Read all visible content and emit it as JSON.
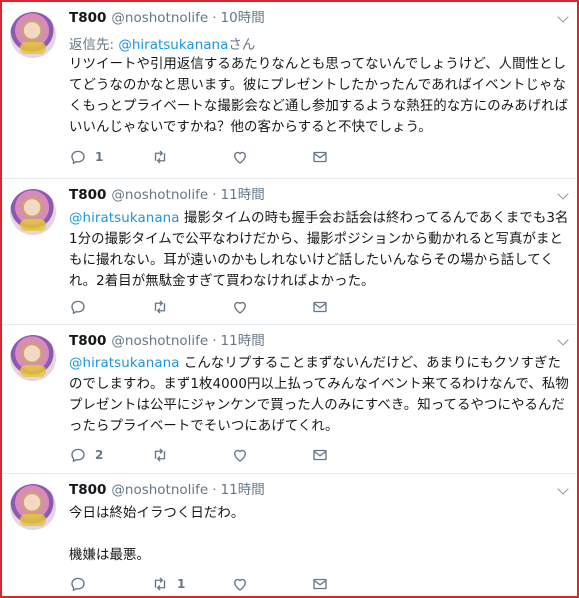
{
  "tweets": [
    {
      "name": "T800",
      "handle": "@noshotnolife",
      "sep": "·",
      "time": "10時間",
      "reply_prefix": "返信先: ",
      "reply_handle": "@hiratsukanana",
      "reply_suffix": "さん",
      "mention": "",
      "text": "リツイートや引用返信するあたりなんとも思ってないんでしょうけど、人間性としてどうなのかなと思います。彼にプレゼントしたかったんであればイベントじゃなくもっとプライベートな撮影会など通し参加するような熱狂的な方にのみあげればいいんじゃないですかね？他の客からすると不快でしょう。",
      "reply_count": "1",
      "retweet_count": "",
      "like_count": ""
    },
    {
      "name": "T800",
      "handle": "@noshotnolife",
      "sep": "·",
      "time": "11時間",
      "mention": "@hiratsukanana",
      "text": " 撮影タイムの時も握手会お話会は終わってるんであくまでも3名1分の撮影タイムで公平なわけだから、撮影ポジションから動かれると写真がまともに撮れない。耳が遠いのかもしれないけど話したいんならその場から話してくれ。2着目が無駄金すぎて買わなければよかった。",
      "reply_count": "",
      "retweet_count": "",
      "like_count": ""
    },
    {
      "name": "T800",
      "handle": "@noshotnolife",
      "sep": "·",
      "time": "11時間",
      "mention": "@hiratsukanana",
      "text": " こんなリプすることまずないんだけど、あまりにもクソすぎたのでしますわ。まず1枚4000円以上払ってみんなイベント来てるわけなんで、私物プレゼントは公平にジャンケンで買った人のみにすべき。知ってるやつにやるんだったらプライベートでそいつにあげてくれ。",
      "reply_count": "2",
      "retweet_count": "",
      "like_count": ""
    },
    {
      "name": "T800",
      "handle": "@noshotnolife",
      "sep": "·",
      "time": "11時間",
      "mention": "",
      "text": "今日は終始イラつく日だわ。\n\n機嫌は最悪。",
      "reply_count": "",
      "retweet_count": "1",
      "like_count": ""
    }
  ],
  "colors": {
    "border": "#e0242a",
    "link": "#1b95e0",
    "muted": "#657786",
    "text": "#14171a"
  },
  "icons": [
    "reply-icon",
    "retweet-icon",
    "like-icon",
    "dm-icon",
    "caret-down-icon",
    "avatar"
  ]
}
